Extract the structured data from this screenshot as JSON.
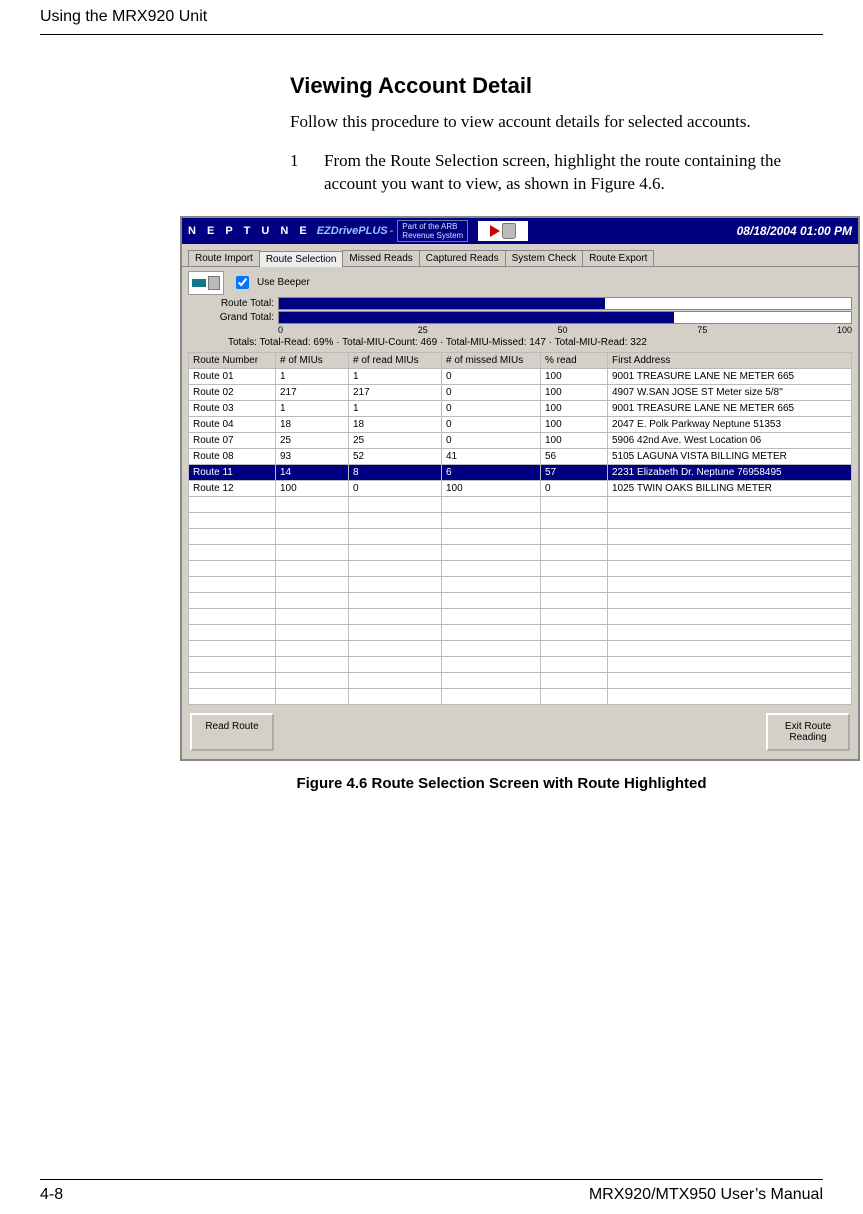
{
  "header": "Using the MRX920 Unit",
  "section_title": "Viewing Account Detail",
  "intro": "Follow this procedure to view account details for selected accounts.",
  "step_num": "1",
  "step_text": "From the Route Selection screen, highlight the route containing the account you want to view, as shown in Figure 4.6.",
  "figure_caption": "Figure 4.6   Route Selection Screen with Route Highlighted",
  "footer_left": "4-8",
  "footer_right": "MRX920/MTX950 User’s Manual",
  "app": {
    "brand": "N E P T U N E",
    "ez": "EZDrivePLUS",
    "sub1": "Part of the ARB",
    "sub2": "Revenue System",
    "datetime": "08/18/2004 01:00 PM",
    "tabs": [
      "Route Import",
      "Route Selection",
      "Missed Reads",
      "Captured Reads",
      "System Check",
      "Route Export"
    ],
    "active_tab_index": 1,
    "use_beeper_label": "Use Beeper",
    "route_total_label": "Route Total:",
    "grand_total_label": "Grand Total:",
    "axis": [
      "0",
      "25",
      "50",
      "75",
      "100"
    ],
    "totals_line": "Totals:  Total-Read: 69%  ·  Total-MIU-Count: 469  ·  Total-MIU-Missed: 147  ·  Total-MIU-Read: 322",
    "columns": [
      "Route Number",
      "# of MIUs",
      "# of read MIUs",
      "# of missed MIUs",
      "% read",
      "First Address"
    ],
    "rows": [
      {
        "rn": "Route 01",
        "m": "1",
        "rm": "1",
        "mm": "0",
        "pr": "100",
        "fa": "9001 TREASURE LANE NE   METER 665"
      },
      {
        "rn": "Route 02",
        "m": "217",
        "rm": "217",
        "mm": "0",
        "pr": "100",
        "fa": "4907 W.SAN JOSE ST     Meter size  5/8''"
      },
      {
        "rn": "Route 03",
        "m": "1",
        "rm": "1",
        "mm": "0",
        "pr": "100",
        "fa": "9001 TREASURE LANE NE   METER 665"
      },
      {
        "rn": "Route 04",
        "m": "18",
        "rm": "18",
        "mm": "0",
        "pr": "100",
        "fa": "2047 E. Polk Parkway    Neptune 51353"
      },
      {
        "rn": "Route 07",
        "m": "25",
        "rm": "25",
        "mm": "0",
        "pr": "100",
        "fa": "5906 42nd Ave. West     Location 06"
      },
      {
        "rn": "Route 08",
        "m": "93",
        "rm": "52",
        "mm": "41",
        "pr": "56",
        "fa": "5105 LAGUNA VISTA      BILLING METER"
      },
      {
        "rn": "Route 11",
        "m": "14",
        "rm": "8",
        "mm": "6",
        "pr": "57",
        "fa": "2231 Elizabeth Dr.      Neptune 76958495",
        "sel": true
      },
      {
        "rn": "Route 12",
        "m": "100",
        "rm": "0",
        "mm": "100",
        "pr": "0",
        "fa": "1025 TWIN OAKS        BILLING METER"
      }
    ],
    "empty_rows": 13,
    "btn_read": "Read Route",
    "btn_exit": "Exit Route\nReading"
  },
  "chart_data": {
    "type": "bar",
    "title": "Route read progress",
    "series": [
      {
        "name": "Route Total",
        "value_pct": 57
      },
      {
        "name": "Grand Total",
        "value_pct": 69
      }
    ],
    "xaxis_ticks": [
      0,
      25,
      50,
      75,
      100
    ],
    "xlabel": "% read",
    "xlim": [
      0,
      100
    ]
  }
}
